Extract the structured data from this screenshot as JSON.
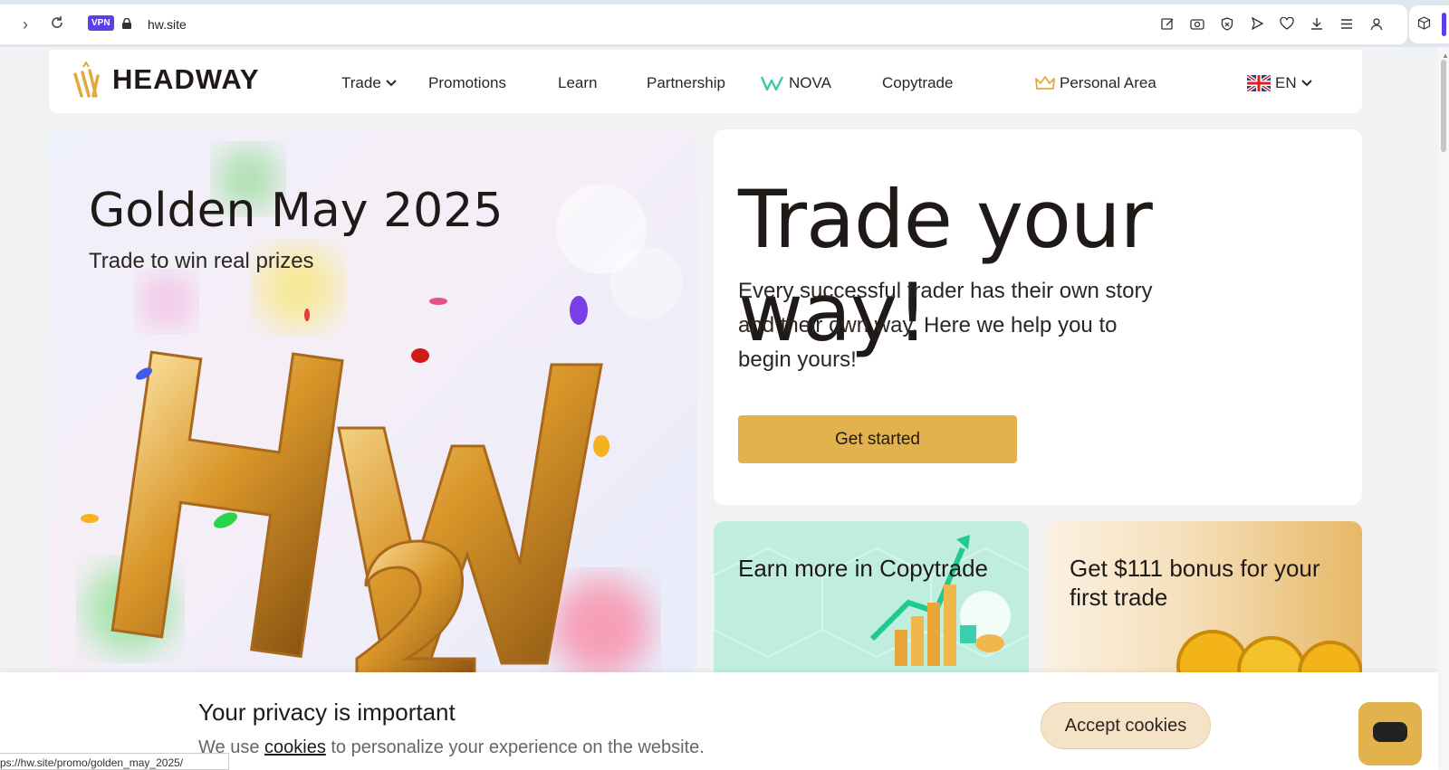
{
  "browser": {
    "url": "hw.site",
    "vpn_label": "VPN",
    "status_url": "ps://hw.site/promo/golden_may_2025/"
  },
  "header": {
    "logo_text": "HEADWAY",
    "nav": {
      "trade": "Trade",
      "promotions": "Promotions",
      "learn": "Learn",
      "partnership": "Partnership",
      "nova": "NOVA",
      "copytrade": "Copytrade",
      "personal_area": "Personal Area",
      "language": "EN"
    }
  },
  "promo": {
    "title": "Golden May 2025",
    "subtitle": "Trade to win real prizes"
  },
  "hero": {
    "title": "Trade your way!",
    "description": "Every successful trader has their own story and their own way. Here we help you to begin yours!",
    "cta": "Get started"
  },
  "cards": {
    "copytrade": "Earn more in Copytrade",
    "bonus": "Get $111 bonus for your first trade"
  },
  "cookie": {
    "title": "Your privacy is important",
    "text_before": "We use ",
    "link": "cookies",
    "text_after": " to personalize your experience on the website.",
    "accept": "Accept cookies"
  },
  "colors": {
    "brand_gold": "#e2b24d",
    "vpn_purple": "#5d3ee8",
    "nova_teal": "#3cc9a5"
  },
  "icons": [
    "chevron-right-icon",
    "reload-icon",
    "lock-icon",
    "edit-icon",
    "camera-icon",
    "shield-icon",
    "send-icon",
    "heart-icon",
    "download-icon",
    "menu-icon",
    "profile-icon",
    "extension-icon",
    "chevron-down-icon",
    "nova-icon",
    "crown-icon",
    "uk-flag-icon",
    "chat-icon"
  ]
}
